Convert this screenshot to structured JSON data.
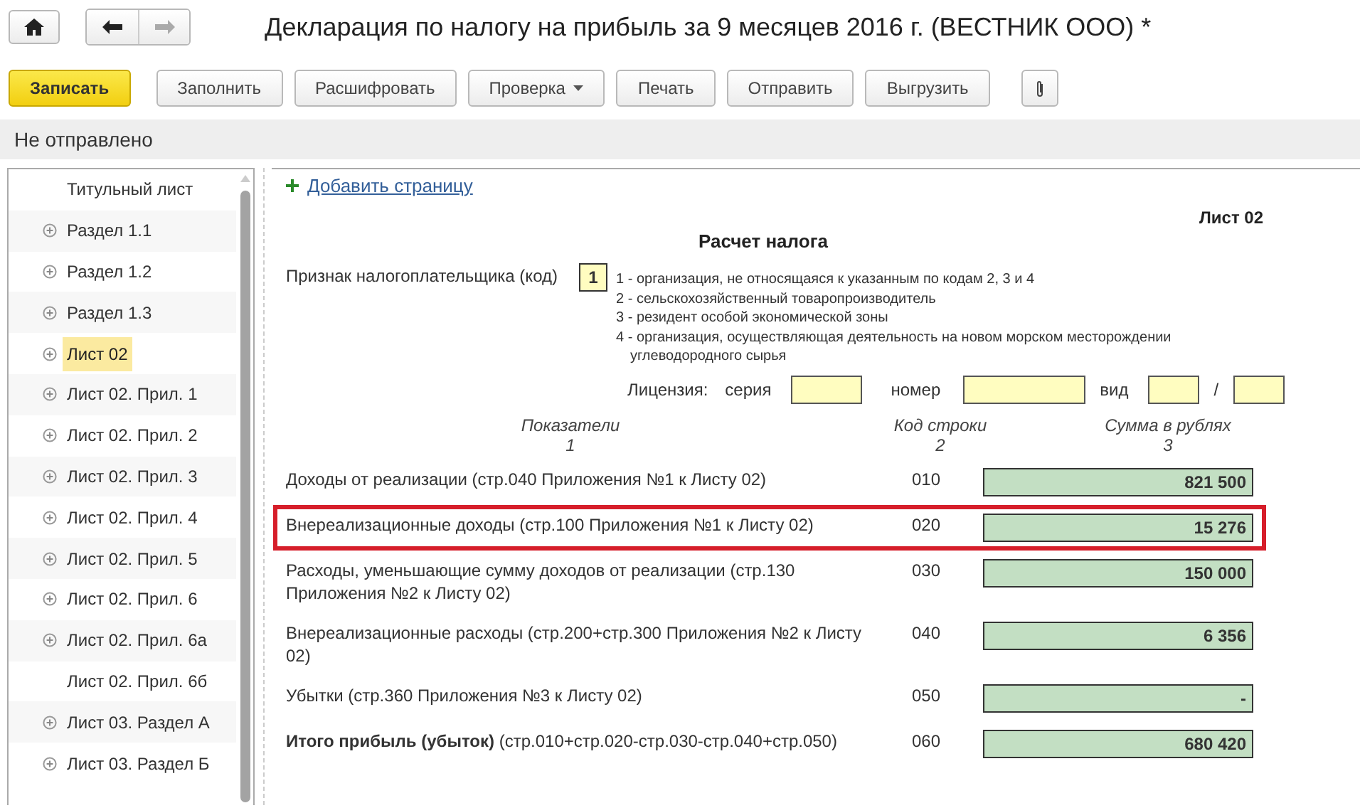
{
  "window": {
    "title": "Декларация по налогу на прибыль за 9 месяцев 2016 г. (ВЕСТНИК ООО) *"
  },
  "toolbar": [
    {
      "label": "Записать",
      "kind": "primary"
    },
    {
      "label": "Заполнить",
      "kind": "plain"
    },
    {
      "label": "Расшифровать",
      "kind": "plain"
    },
    {
      "label": "Проверка",
      "kind": "dropdown"
    },
    {
      "label": "Печать",
      "kind": "plain"
    },
    {
      "label": "Отправить",
      "kind": "plain"
    },
    {
      "label": "Выгрузить",
      "kind": "plain"
    },
    {
      "kind": "attach"
    }
  ],
  "status": "Не отправлено",
  "sidebar": {
    "items": [
      {
        "label": "Титульный лист",
        "expandable": false,
        "selected": false
      },
      {
        "label": "Раздел 1.1",
        "expandable": true,
        "selected": false
      },
      {
        "label": "Раздел 1.2",
        "expandable": true,
        "selected": false
      },
      {
        "label": "Раздел 1.3",
        "expandable": true,
        "selected": false
      },
      {
        "label": "Лист 02",
        "expandable": true,
        "selected": true
      },
      {
        "label": "Лист 02. Прил. 1",
        "expandable": true,
        "selected": false
      },
      {
        "label": "Лист 02. Прил. 2",
        "expandable": true,
        "selected": false
      },
      {
        "label": "Лист 02. Прил. 3",
        "expandable": true,
        "selected": false
      },
      {
        "label": "Лист 02. Прил. 4",
        "expandable": true,
        "selected": false
      },
      {
        "label": "Лист 02. Прил. 5",
        "expandable": true,
        "selected": false
      },
      {
        "label": "Лист 02. Прил. 6",
        "expandable": true,
        "selected": false
      },
      {
        "label": "Лист 02. Прил. 6а",
        "expandable": true,
        "selected": false
      },
      {
        "label": "Лист 02. Прил. 6б",
        "expandable": false,
        "selected": false
      },
      {
        "label": "Лист 03. Раздел А",
        "expandable": true,
        "selected": false
      },
      {
        "label": "Лист 03. Раздел Б",
        "expandable": true,
        "selected": false
      }
    ]
  },
  "form": {
    "add_page_link": "Добавить страницу",
    "sheet": "Лист 02",
    "heading": "Расчет налога",
    "taxpayer_label": "Признак налогоплательщика (код)",
    "taxpayer_code": "1",
    "code_notes": [
      "1 - организация, не относящаяся к указанным по кодам 2, 3 и 4",
      "2 - сельскохозяйственный товаропроизводитель",
      "3 - резидент особой экономической зоны",
      "4 - организация, осуществляющая деятельность на новом морском месторождении углеводородного сырья"
    ],
    "license": {
      "label": "Лицензия:",
      "series_label": "серия",
      "number_label": "номер",
      "kind_label": "вид",
      "separator": "/"
    },
    "columns": [
      {
        "label": "Показатели",
        "number": "1"
      },
      {
        "label": "Код строки",
        "number": "2"
      },
      {
        "label": "Сумма в рублях",
        "number": "3"
      }
    ],
    "rows": [
      {
        "label": "Доходы от реализации (стр.040 Приложения №1 к Листу 02)",
        "code": "010",
        "amount": "821 500",
        "highlighted": false
      },
      {
        "label": "Внереализационные доходы (стр.100 Приложения №1 к Листу 02)",
        "code": "020",
        "amount": "15 276",
        "highlighted": true
      },
      {
        "label": "Расходы, уменьшающие сумму доходов от реализации (стр.130 Приложения №2 к Листу 02)",
        "code": "030",
        "amount": "150 000",
        "highlighted": false
      },
      {
        "label": "Внереализационные расходы (стр.200+стр.300 Приложения №2 к Листу 02)",
        "code": "040",
        "amount": "6 356",
        "highlighted": false
      },
      {
        "label": "Убытки (стр.360 Приложения №3 к Листу 02)",
        "code": "050",
        "amount": "-",
        "highlighted": false
      },
      {
        "label": "**Итого прибыль (убыток)**   (стр.010+стр.020-стр.030-стр.040+стр.050)",
        "code": "060",
        "amount": "680 420",
        "highlighted": false
      }
    ]
  }
}
